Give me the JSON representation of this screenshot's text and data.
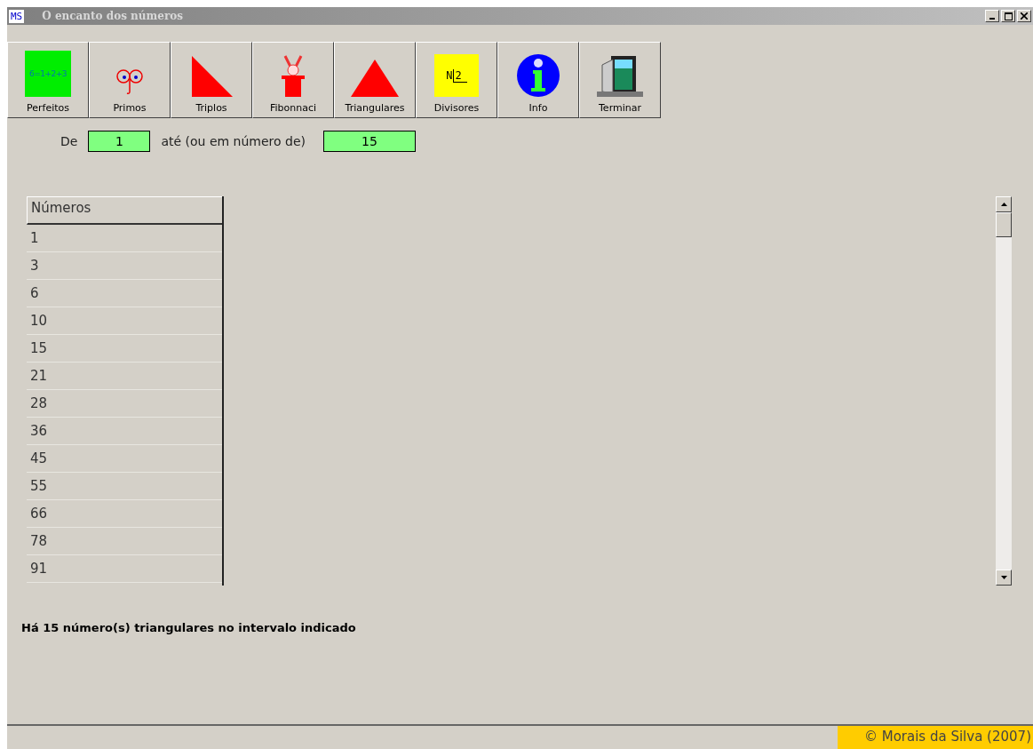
{
  "window": {
    "app_badge": "MS",
    "title": "O encanto dos números"
  },
  "toolbar": [
    {
      "kind": "perfect",
      "label": "Perfeitos",
      "icon_text": "6=1+2+3"
    },
    {
      "kind": "primes",
      "label": "Primos"
    },
    {
      "kind": "right-triangle",
      "label": "Triplos"
    },
    {
      "kind": "rabbit",
      "label": "Fibonnaci"
    },
    {
      "kind": "triangle",
      "label": "Triangulares"
    },
    {
      "kind": "divisor",
      "label": "Divisores",
      "icon_text": "N",
      "icon_text_2": "2"
    },
    {
      "kind": "info",
      "label": "Info"
    },
    {
      "kind": "exit",
      "label": "Terminar"
    }
  ],
  "range": {
    "from_label": "De",
    "from_value": "1",
    "to_label": "até (ou em número de)",
    "to_value": "15"
  },
  "table": {
    "column": "Números",
    "rows": [
      "1",
      "3",
      "6",
      "10",
      "15",
      "21",
      "28",
      "36",
      "45",
      "55",
      "66",
      "78",
      "91"
    ]
  },
  "status_message": "Há 15 número(s) triangulares no intervalo indicado",
  "footer": "© Morais da Silva (2007)"
}
